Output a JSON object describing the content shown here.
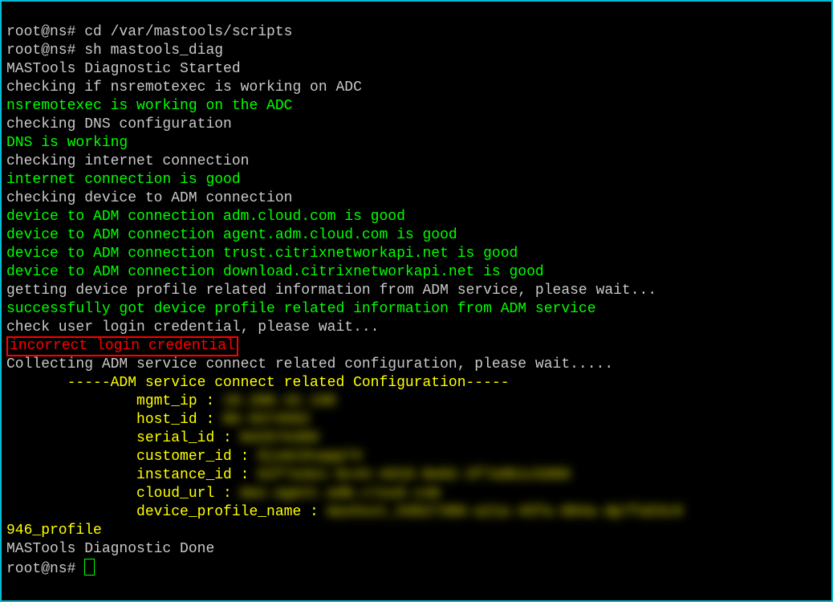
{
  "prompt": "root@ns# ",
  "commands": {
    "cd": "cd /var/mastools/scripts",
    "run": "sh mastools_diag"
  },
  "lines": {
    "started": "MASTools Diagnostic Started",
    "chk_nsremote": "checking if nsremotexec is working on ADC",
    "ok_nsremote": "nsremotexec is working on the ADC",
    "chk_dns": "checking DNS configuration",
    "ok_dns": "DNS is working",
    "chk_internet": "checking internet connection",
    "ok_internet": "internet connection is good",
    "chk_adm": "checking device to ADM connection",
    "ok_adm1": "device to ADM connection adm.cloud.com is good",
    "ok_adm2": "device to ADM connection agent.adm.cloud.com is good",
    "ok_adm3": "device to ADM connection trust.citrixnetworkapi.net is good",
    "ok_adm4": "device to ADM connection download.citrixnetworkapi.net is good",
    "get_profile": "getting device profile related information from ADM service, please wait...",
    "ok_profile": "successfully got device profile related information from ADM service",
    "chk_login": "check user login credential, please wait...",
    "err_login": "incorrect login credential",
    "collecting": "Collecting ADM service connect related configuration, please wait.....",
    "header": "       -----ADM service connect related Configuration-----",
    "profile_tail": "946_profile",
    "done": "MASTools Diagnostic Done"
  },
  "config_labels": {
    "mgmt_ip": "               mgmt_ip : ",
    "host_id": "               host_id : ",
    "serial_id": "               serial_id : ",
    "customer_id": "               customer_id : ",
    "instance_id": "               instance_id : ",
    "cloud_url": "               cloud_url : ",
    "device_profile_name": "               device_profile_name : "
  },
  "config_values": {
    "mgmt_ip": "10.200.42.198",
    "host_id": "NS-9374562",
    "serial_id": "N4257A389",
    "customer_id": "8jxmi9sapp74",
    "instance_id": "b2f7a3e1-9c44-4d18-8e02-3f7a9b1c5d60",
    "cloud_url": "mas-agent.adm.cloud.com",
    "device_profile_name": "mashost_hd927300-a21a-45fa-884a-dp7fa53c9"
  }
}
